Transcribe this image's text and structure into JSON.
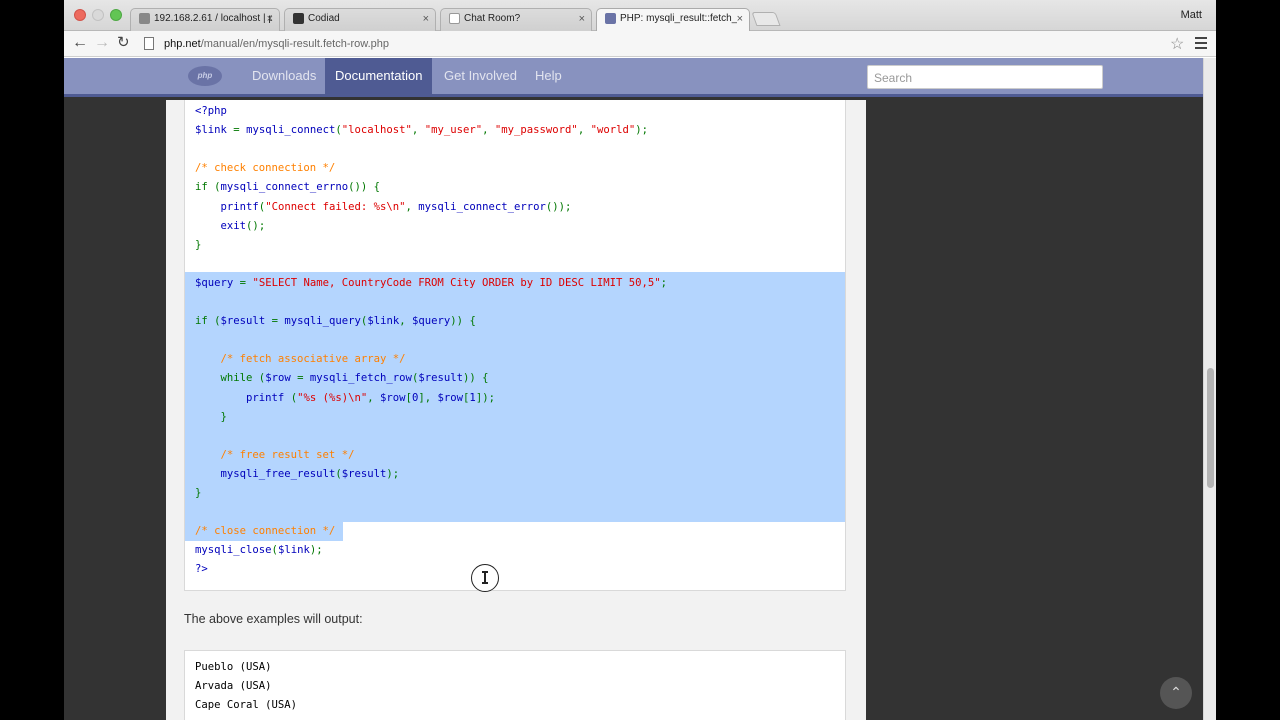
{
  "browser": {
    "tabs": [
      {
        "label": "192.168.2.61 / localhost | p",
        "favicon": "phpmyadmin-favicon-icon",
        "active": false
      },
      {
        "label": "Codiad",
        "favicon": "codiad-favicon-icon",
        "active": false
      },
      {
        "label": "Chat Room?",
        "favicon": "page-favicon-icon",
        "active": false
      },
      {
        "label": "PHP: mysqli_result::fetch_",
        "favicon": "php-favicon-icon",
        "active": true
      }
    ],
    "close_glyph": "×",
    "user_name": "Matt",
    "url_host": "php.net",
    "url_path": "/manual/en/mysqli-result.fetch-row.php"
  },
  "site": {
    "logo_text": "php",
    "nav": [
      {
        "label": "Downloads",
        "active": false
      },
      {
        "label": "Documentation",
        "active": true
      },
      {
        "label": "Get Involved",
        "active": false
      },
      {
        "label": "Help",
        "active": false
      }
    ],
    "search_placeholder": "Search"
  },
  "code_lines": [
    "<?php",
    "$link = mysqli_connect(\"localhost\", \"my_user\", \"my_password\", \"world\");",
    "",
    "/* check connection */",
    "if (mysqli_connect_errno()) {",
    "    printf(\"Connect failed: %s\\n\", mysqli_connect_error());",
    "    exit();",
    "}",
    "",
    "$query = \"SELECT Name, CountryCode FROM City ORDER by ID DESC LIMIT 50,5\";",
    "",
    "if ($result = mysqli_query($link, $query)) {",
    "",
    "    /* fetch associative array */",
    "    while ($row = mysqli_fetch_row($result)) {",
    "        printf (\"%s (%s)\\n\", $row[0], $row[1]);",
    "    }",
    "",
    "    /* free result set */",
    "    mysqli_free_result($result);",
    "}",
    "",
    "/* close connection */",
    "mysqli_close($link);",
    "?>"
  ],
  "output_label": "The above examples will output:",
  "output_lines": [
    "Pueblo (USA)",
    "Arvada (USA)",
    "Cape Coral (USA)"
  ],
  "colors": {
    "nav_bg": "#8892bf",
    "nav_active": "#4f5b93",
    "selection": "#b4d5fe",
    "keyword": "#007700",
    "string": "#dd0000",
    "comment": "#ff8000",
    "default": "#0000bb"
  },
  "back_to_top_glyph": "⌃"
}
